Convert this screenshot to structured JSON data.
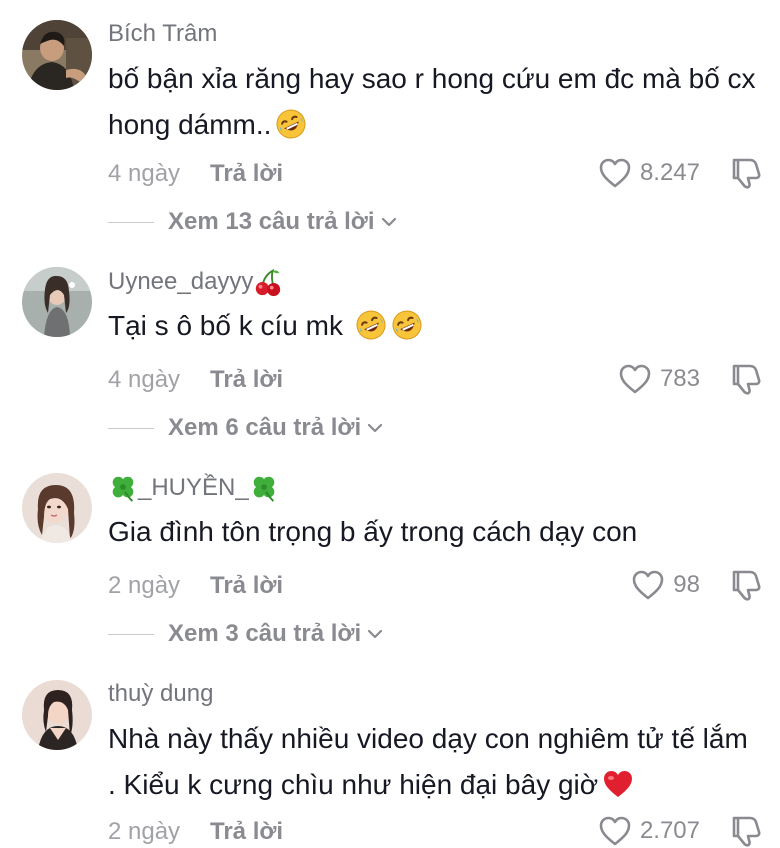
{
  "comments": [
    {
      "username": "Bích Trâm",
      "text": "bố bận xỉa răng hay sao r hong cứu em đc mà bố cx hong dámm..",
      "age": "4 ngày",
      "reply_label": "Trả lời",
      "likes": "8.247",
      "view_replies": "Xem 13 câu trả lời"
    },
    {
      "username": "Uynee_dayyy",
      "text": "Tại s ô bố k cíu mk",
      "age": "4 ngày",
      "reply_label": "Trả lời",
      "likes": "783",
      "view_replies": "Xem 6 câu trả lời"
    },
    {
      "username": "_HUYỀN_",
      "text": "Gia đình tôn trọng b ấy trong cách dạy con",
      "age": "2 ngày",
      "reply_label": "Trả lời",
      "likes": "98",
      "view_replies": "Xem 3 câu trả lời"
    },
    {
      "username": "thuỳ dung",
      "text": "Nhà này thấy nhiều video dạy con nghiêm tử tế lắm . Kiểu k cưng chìu như hiện đại bây giờ",
      "age": "2 ngày",
      "reply_label": "Trả lời",
      "likes": "2.707"
    }
  ],
  "icons": {
    "like": "heart-outline-icon",
    "dislike": "thumbs-down-icon",
    "expand": "chevron-down-icon",
    "laugh": "rofl-emoji",
    "cherry": "cherries-emoji",
    "clover": "four-leaf-clover-emoji",
    "heart": "red-heart-emoji"
  },
  "colors": {
    "text": "#161823",
    "secondary": "#8a8b91",
    "muted": "#a1a2a7",
    "heart_emoji": "#e0202e"
  }
}
